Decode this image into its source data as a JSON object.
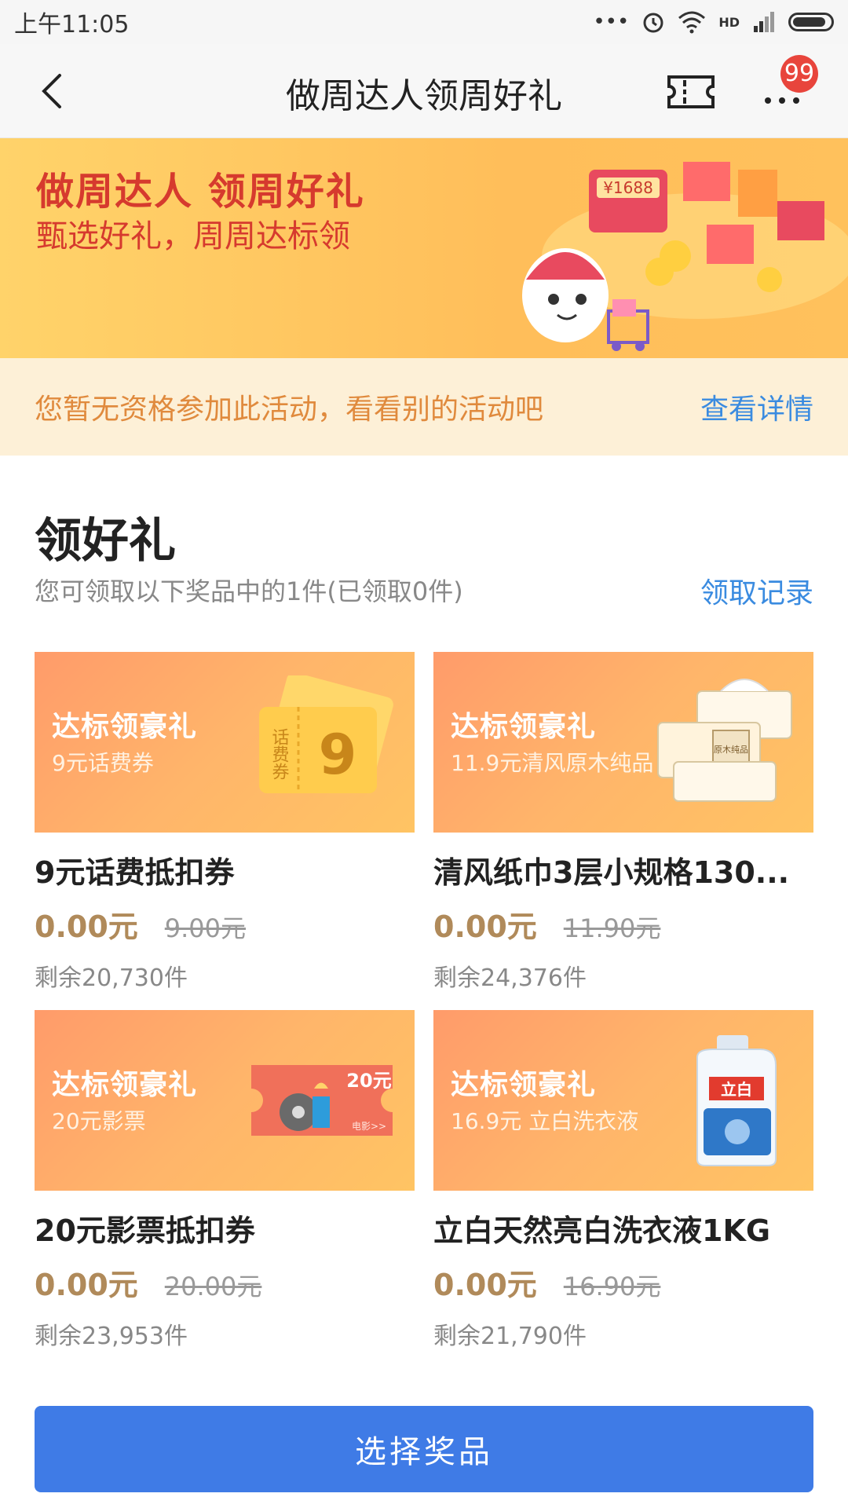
{
  "status_bar": {
    "time": "上午11:05",
    "dots": "•••",
    "network": "HD"
  },
  "nav": {
    "title": "做周达人领周好礼",
    "badge_count": "99"
  },
  "banner": {
    "title": "做周达人  领周好礼",
    "subtitle": "甄选好礼，周周达标领",
    "art_price": "¥1688"
  },
  "notice": {
    "text": "您暂无资格参加此活动，看看别的活动吧",
    "link": "查看详情"
  },
  "section": {
    "title": "领好礼",
    "subtitle": "您可领取以下奖品中的1件(已领取0件)",
    "link": "领取记录"
  },
  "cards": [
    {
      "tag": "达标领豪礼",
      "tag_sub": "9元话费券",
      "art_text": "9",
      "art_label": "话费券",
      "name": "9元话费抵扣券",
      "price_now": "0.00元",
      "price_old": "9.00元",
      "remain": "剩余20,730件"
    },
    {
      "tag": "达标领豪礼",
      "tag_sub": "11.9元清风原木纯品",
      "art_text": "原木纯品",
      "art_label": "",
      "name": "清风纸巾3层小规格130...",
      "price_now": "0.00元",
      "price_old": "11.90元",
      "remain": "剩余24,376件"
    },
    {
      "tag": "达标领豪礼",
      "tag_sub": "20元影票",
      "art_text": "20元",
      "art_label": "电影>>",
      "name": "20元影票抵扣券",
      "price_now": "0.00元",
      "price_old": "20.00元",
      "remain": "剩余23,953件"
    },
    {
      "tag": "达标领豪礼",
      "tag_sub": "16.9元 立白洗衣液",
      "art_text": "立白",
      "art_label": "",
      "name": "立白天然亮白洗衣液1KG",
      "price_now": "0.00元",
      "price_old": "16.90元",
      "remain": "剩余21,790件"
    }
  ],
  "footer": {
    "button": "选择奖品"
  },
  "colors": {
    "accent_blue": "#3f7be6",
    "link_blue": "#3a8be0",
    "banner_red": "#d63a2e",
    "notice_orange": "#e08a3d",
    "price_gold": "#b08a5a"
  }
}
